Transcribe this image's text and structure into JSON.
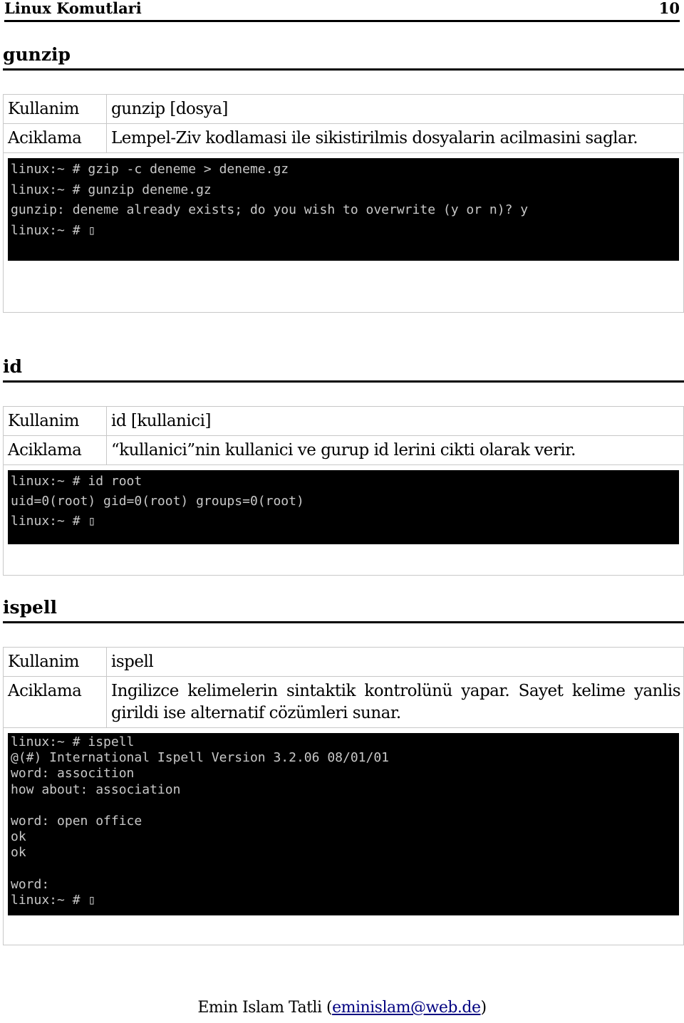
{
  "header": {
    "title": "Linux Komutlari",
    "page": "10"
  },
  "sections": [
    {
      "title": "gunzip",
      "usage_label": "Kullanim",
      "usage": "gunzip [dosya]",
      "desc_label": "Aciklama",
      "desc": "Lempel-Ziv kodlamasi ile sikistirilmis dosyalarin acilmasini saglar.",
      "terminal": [
        "linux:~ # gzip -c deneme > deneme.gz",
        "linux:~ # gunzip deneme.gz",
        "gunzip: deneme already exists; do you wish to overwrite (y or n)? y",
        "linux:~ # ▯"
      ]
    },
    {
      "title": "id",
      "usage_label": "Kullanim",
      "usage": "id [kullanici]",
      "desc_label": "Aciklama",
      "desc": "“kullanici”nin kullanici ve gurup id lerini cikti olarak verir.",
      "terminal": [
        "linux:~ # id root",
        "uid=0(root) gid=0(root) groups=0(root)",
        "linux:~ # ▯"
      ]
    },
    {
      "title": "ispell",
      "usage_label": "Kullanim",
      "usage": "ispell",
      "desc_label": "Aciklama",
      "desc": "Ingilizce kelimelerin sintaktik kontrolünü yapar. Sayet kelime yanlis girildi ise alternatif cözümleri sunar.",
      "terminal": [
        "linux:~ # ispell",
        "@(#) International Ispell Version 3.2.06 08/01/01",
        "word: assocition",
        "how about: association",
        "",
        "word: open office",
        "ok",
        "ok",
        "",
        "word:",
        "linux:~ # ▯"
      ]
    }
  ],
  "footer": {
    "author": "Emin Islam Tatli (",
    "email": "eminislam@web.de",
    "close": ")"
  }
}
